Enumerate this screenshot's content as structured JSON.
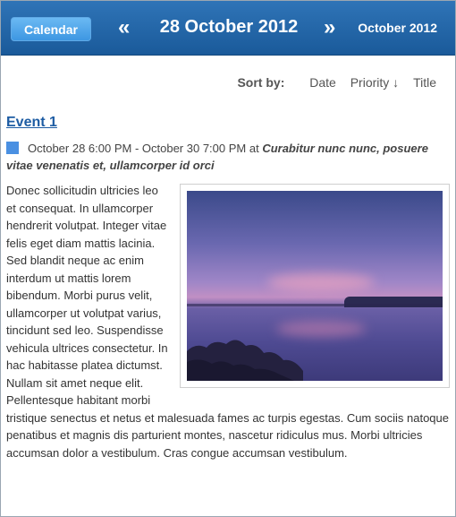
{
  "header": {
    "calendar_button": "Calendar",
    "prev_arrow": "«",
    "date_title": "28 October 2012",
    "next_arrow": "»",
    "month_link": "October 2012"
  },
  "sort": {
    "label": "Sort by:",
    "options": [
      "Date",
      "Priority ↓",
      "Title"
    ]
  },
  "event": {
    "title": "Event 1",
    "category_color": "#4a90e2",
    "time_range": "October 28 6:00 PM - October 30 7:00 PM at ",
    "location": "Curabitur nunc nunc, posuere vitae venenatis et, ullamcorper id orci",
    "description": "Donec sollicitudin ultricies leo et consequat. In ullamcorper hendrerit volutpat. Integer vitae felis eget diam mattis lacinia. Sed blandit neque ac enim interdum ut mattis lorem bibendum. Morbi purus velit, ullamcorper ut volutpat varius, tincidunt sed leo. Suspendisse vehicula ultrices consectetur. In hac habitasse platea dictumst. Nullam sit amet neque elit. Pellentesque habitant morbi tristique senectus et netus et malesuada fames ac turpis egestas. Cum sociis natoque penatibus et magnis dis parturient montes, nascetur ridiculus mus. Morbi ultricies accumsan dolor a vestibulum. Cras congue accumsan vestibulum."
  }
}
